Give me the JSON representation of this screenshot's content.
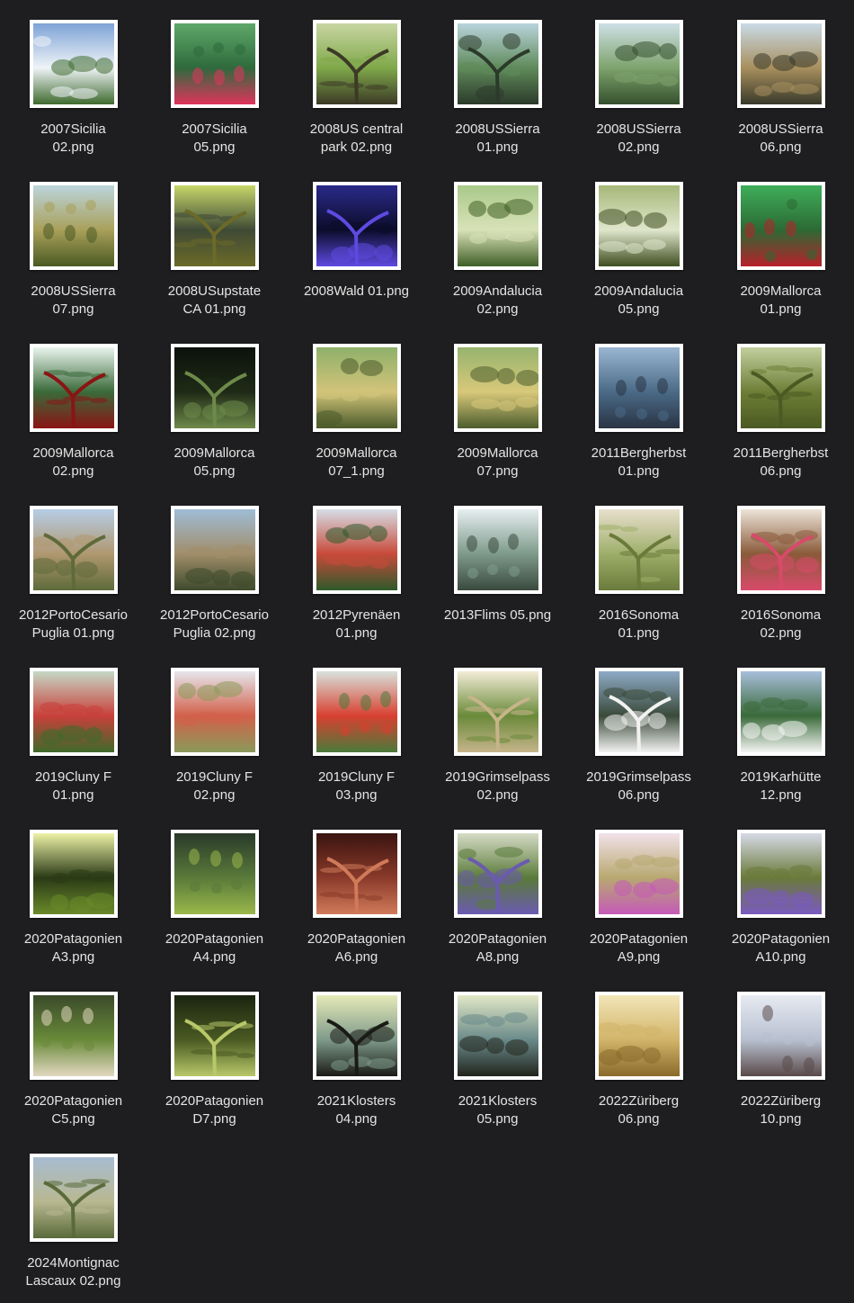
{
  "files": [
    {
      "line1": "2007Sicilia",
      "line2": "02.png",
      "icon": "image-file-icon",
      "c1": "#7ea3d6",
      "c2": "#3f6b2e",
      "c3": "#eef3f7"
    },
    {
      "line1": "2007Sicilia",
      "line2": "05.png",
      "icon": "image-file-icon",
      "c1": "#5fa86a",
      "c2": "#e0345c",
      "c3": "#2e6a3c"
    },
    {
      "line1": "2008US central",
      "line2": "park 02.png",
      "icon": "image-file-icon",
      "c1": "#c8d6a2",
      "c2": "#3c3a26",
      "c3": "#7fa84a"
    },
    {
      "line1": "2008USSierra",
      "line2": "01.png",
      "icon": "image-file-icon",
      "c1": "#b9d4dc",
      "c2": "#2b3a2a",
      "c3": "#5f8a5a"
    },
    {
      "line1": "2008USSierra",
      "line2": "02.png",
      "icon": "image-file-icon",
      "c1": "#cde0e6",
      "c2": "#34502e",
      "c3": "#7ea36c"
    },
    {
      "line1": "2008USSierra",
      "line2": "06.png",
      "icon": "image-file-icon",
      "c1": "#c9dbe6",
      "c2": "#38392a",
      "c3": "#a88f5e"
    },
    {
      "line1": "2008USSierra",
      "line2": "07.png",
      "icon": "image-file-icon",
      "c1": "#bcd5dd",
      "c2": "#4b5a22",
      "c3": "#a9a05a"
    },
    {
      "line1": "2008USupstate",
      "line2": "CA 01.png",
      "icon": "image-file-icon",
      "c1": "#c7d76a",
      "c2": "#6b6a28",
      "c3": "#3f4a36"
    },
    {
      "line1": "2008Wald 01.png",
      "line2": "",
      "icon": "image-file-icon",
      "c1": "#2a2a8a",
      "c2": "#5e4ae0",
      "c3": "#0c0c2a"
    },
    {
      "line1": "2009Andalucia",
      "line2": "02.png",
      "icon": "image-file-icon",
      "c1": "#a9c98a",
      "c2": "#3f5e26",
      "c3": "#d9e2b8"
    },
    {
      "line1": "2009Andalucia",
      "line2": "05.png",
      "icon": "image-file-icon",
      "c1": "#a6b879",
      "c2": "#3f4e20",
      "c3": "#e0e6cc"
    },
    {
      "line1": "2009Mallorca",
      "line2": "01.png",
      "icon": "image-file-icon",
      "c1": "#3fae5a",
      "c2": "#b8202a",
      "c3": "#2c6a34"
    },
    {
      "line1": "2009Mallorca",
      "line2": "02.png",
      "icon": "image-file-icon",
      "c1": "#eaf5ee",
      "c2": "#8a1414",
      "c3": "#3a6a3a"
    },
    {
      "line1": "2009Mallorca",
      "line2": "05.png",
      "icon": "image-file-icon",
      "c1": "#0c120c",
      "c2": "#6e8a4a",
      "c3": "#1e2a16"
    },
    {
      "line1": "2009Mallorca",
      "line2": "07_1.png",
      "icon": "image-file-icon",
      "c1": "#8fb06a",
      "c2": "#4a5a2a",
      "c3": "#d2c47a"
    },
    {
      "line1": "2009Mallorca",
      "line2": "07.png",
      "icon": "image-file-icon",
      "c1": "#96b46e",
      "c2": "#4c5c2c",
      "c3": "#d8c87a"
    },
    {
      "line1": "2011Bergherbst",
      "line2": "01.png",
      "icon": "image-file-icon",
      "c1": "#9ab6d2",
      "c2": "#2a3444",
      "c3": "#4a6a86"
    },
    {
      "line1": "2011Bergherbst",
      "line2": "06.png",
      "icon": "image-file-icon",
      "c1": "#c2cf9e",
      "c2": "#4a5a22",
      "c3": "#6e7e36"
    },
    {
      "line1": "2012PortoCesario",
      "line2": "Puglia 01.png",
      "icon": "image-file-icon",
      "c1": "#b6cde6",
      "c2": "#5e6a3a",
      "c3": "#b09870"
    },
    {
      "line1": "2012PortoCesario",
      "line2": "Puglia 02.png",
      "icon": "image-file-icon",
      "c1": "#9fbcd6",
      "c2": "#3e4a2c",
      "c3": "#a08e6a"
    },
    {
      "line1": "2012Pyrenäen",
      "line2": "01.png",
      "icon": "image-file-icon",
      "c1": "#d6dde6",
      "c2": "#2e5a2a",
      "c3": "#c84a3a"
    },
    {
      "line1": "2013Flims 05.png",
      "line2": "",
      "icon": "image-file-icon",
      "c1": "#e6eef0",
      "c2": "#3a4a3e",
      "c3": "#7e9a8a"
    },
    {
      "line1": "2016Sonoma",
      "line2": "01.png",
      "icon": "image-file-icon",
      "c1": "#e8e0cc",
      "c2": "#6a7a3a",
      "c3": "#9eae6a"
    },
    {
      "line1": "2016Sonoma",
      "line2": "02.png",
      "icon": "image-file-icon",
      "c1": "#ece4d8",
      "c2": "#d84a6a",
      "c3": "#8a5a3a"
    },
    {
      "line1": "2019Cluny F",
      "line2": "01.png",
      "icon": "image-file-icon",
      "c1": "#c6d8c6",
      "c2": "#3e6a2a",
      "c3": "#c8403a"
    },
    {
      "line1": "2019Cluny F",
      "line2": "02.png",
      "icon": "image-file-icon",
      "c1": "#e6e6ec",
      "c2": "#8a9a5a",
      "c3": "#d2604a"
    },
    {
      "line1": "2019Cluny F",
      "line2": "03.png",
      "icon": "image-file-icon",
      "c1": "#d8e2dc",
      "c2": "#4a7a3a",
      "c3": "#d84030"
    },
    {
      "line1": "2019Grimselpass",
      "line2": "02.png",
      "icon": "image-file-icon",
      "c1": "#f2ecd6",
      "c2": "#c6b48a",
      "c3": "#6a8a3a"
    },
    {
      "line1": "2019Grimselpass",
      "line2": "06.png",
      "icon": "image-file-icon",
      "c1": "#8eaac6",
      "c2": "#f2f2f2",
      "c3": "#3a4a3a"
    },
    {
      "line1": "2019Karhütte",
      "line2": "12.png",
      "icon": "image-file-icon",
      "c1": "#a8bedc",
      "c2": "#f4f6f4",
      "c3": "#3a6a3a"
    },
    {
      "line1": "2020Patagonien",
      "line2": "A3.png",
      "icon": "image-file-icon",
      "c1": "#eef2a6",
      "c2": "#6a8a2a",
      "c3": "#2a3a16"
    },
    {
      "line1": "2020Patagonien",
      "line2": "A4.png",
      "icon": "image-file-icon",
      "c1": "#2a3a2a",
      "c2": "#9ab84a",
      "c3": "#5a7a3a"
    },
    {
      "line1": "2020Patagonien",
      "line2": "A6.png",
      "icon": "image-file-icon",
      "c1": "#3a1410",
      "c2": "#d07a5a",
      "c3": "#8a3a2a"
    },
    {
      "line1": "2020Patagonien",
      "line2": "A8.png",
      "icon": "image-file-icon",
      "c1": "#d6dcc6",
      "c2": "#6a5ab0",
      "c3": "#5a7a3a"
    },
    {
      "line1": "2020Patagonien",
      "line2": "A9.png",
      "icon": "image-file-icon",
      "c1": "#f2e2ea",
      "c2": "#c45ab8",
      "c3": "#b8a870"
    },
    {
      "line1": "2020Patagonien",
      "line2": "A10.png",
      "icon": "image-file-icon",
      "c1": "#d6dae6",
      "c2": "#7a5ac0",
      "c3": "#6a7a3a"
    },
    {
      "line1": "2020Patagonien",
      "line2": "C5.png",
      "icon": "image-file-icon",
      "c1": "#3a4a2a",
      "c2": "#e2d8c0",
      "c3": "#6a8a3a"
    },
    {
      "line1": "2020Patagonien",
      "line2": "D7.png",
      "icon": "image-file-icon",
      "c1": "#1a2410",
      "c2": "#b8c86a",
      "c3": "#4a5a22"
    },
    {
      "line1": "2021Klosters",
      "line2": "04.png",
      "icon": "image-file-icon",
      "c1": "#e6eab8",
      "c2": "#1a1a16",
      "c3": "#7e9a8a"
    },
    {
      "line1": "2021Klosters",
      "line2": "05.png",
      "icon": "image-file-icon",
      "c1": "#e2e8c6",
      "c2": "#22241c",
      "c3": "#6a8a8a"
    },
    {
      "line1": "2022Züriberg",
      "line2": "06.png",
      "icon": "image-file-icon",
      "c1": "#f2e6b8",
      "c2": "#8a6a2a",
      "c3": "#d2b46a"
    },
    {
      "line1": "2022Züriberg",
      "line2": "10.png",
      "icon": "image-file-icon",
      "c1": "#e6eaf2",
      "c2": "#5a4a4a",
      "c3": "#b8c0d0"
    },
    {
      "line1": "2024Montignac",
      "line2": "Lascaux 02.png",
      "icon": "image-file-icon",
      "c1": "#a8bcd2",
      "c2": "#5a6a3a",
      "c3": "#b8b890"
    }
  ]
}
